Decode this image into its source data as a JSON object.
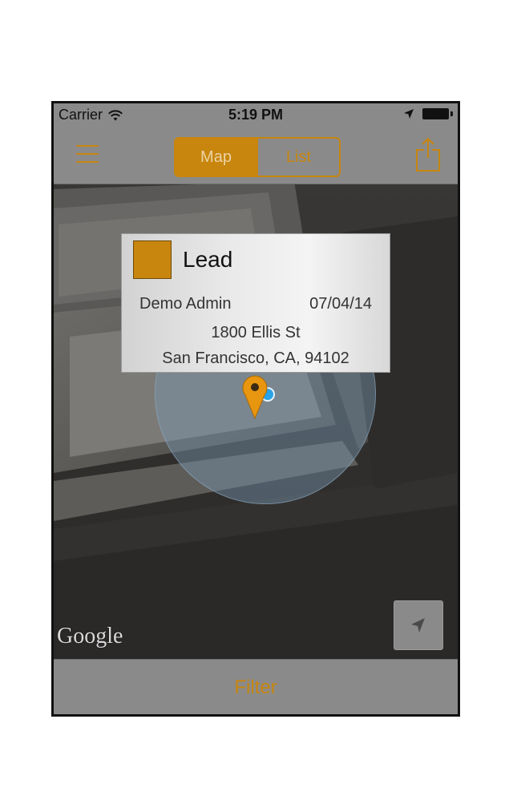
{
  "status_bar": {
    "carrier": "Carrier",
    "time": "5:19 PM",
    "icons": [
      "wifi-icon",
      "location-arrow-icon",
      "battery-icon"
    ]
  },
  "nav_bar": {
    "menu_icon": "hamburger-icon",
    "tabs": [
      {
        "label": "Map",
        "selected": true
      },
      {
        "label": "List",
        "selected": false
      }
    ],
    "share_icon": "share-icon"
  },
  "map": {
    "callout": {
      "title": "Lead",
      "owner": "Demo Admin",
      "date": "07/04/14",
      "street": "1800 Ellis St",
      "city": "San Francisco, CA, 94102",
      "swatch_color": "#c8860e"
    },
    "attribution": "Google",
    "locate_icon": "location-arrow-icon"
  },
  "bottom_bar": {
    "filter_label": "Filter"
  },
  "colors": {
    "accent": "#c8860e",
    "bar_background": "#8a8a8a",
    "user_location": "#2aa3e6"
  }
}
